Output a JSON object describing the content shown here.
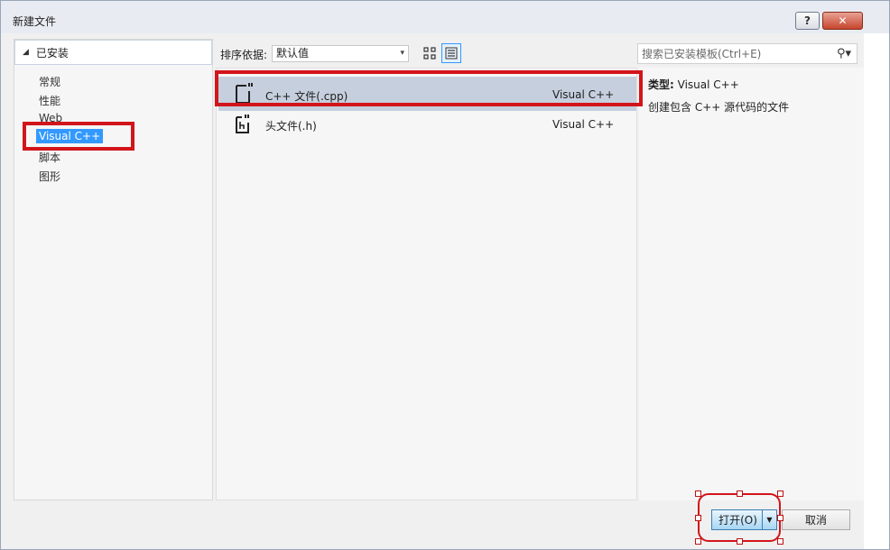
{
  "window": {
    "title": "新建文件",
    "help_label": "?",
    "close_label": "✕"
  },
  "sidebar": {
    "header": "已安装",
    "items": [
      {
        "label": "常规",
        "selected": false
      },
      {
        "label": "性能",
        "selected": false
      },
      {
        "label": "Web",
        "selected": false
      },
      {
        "label": "Visual C++",
        "selected": true
      },
      {
        "label": "脚本",
        "selected": false
      },
      {
        "label": "图形",
        "selected": false
      }
    ]
  },
  "toolbar": {
    "sort_label": "排序依据:",
    "sort_value": "默认值",
    "view_modes": [
      "grid-view-icon",
      "list-view-icon"
    ],
    "active_view": "list-view-icon"
  },
  "search": {
    "placeholder": "搜索已安装模板(Ctrl+E)"
  },
  "templates": [
    {
      "name": "C++ 文件(.cpp)",
      "language": "Visual C++",
      "icon": "cpp-file-icon",
      "selected": true
    },
    {
      "name": "头文件(.h)",
      "language": "Visual C++",
      "icon": "header-file-icon",
      "selected": false
    }
  ],
  "detail": {
    "type_label": "类型:",
    "type_value": "Visual C++",
    "description": "创建包含 C++ 源代码的文件"
  },
  "buttons": {
    "open": "打开(O)",
    "cancel": "取消"
  },
  "colors": {
    "selection": "#3399ff",
    "row_selected": "#c6cfdd",
    "annotation_red": "#d2151b"
  }
}
